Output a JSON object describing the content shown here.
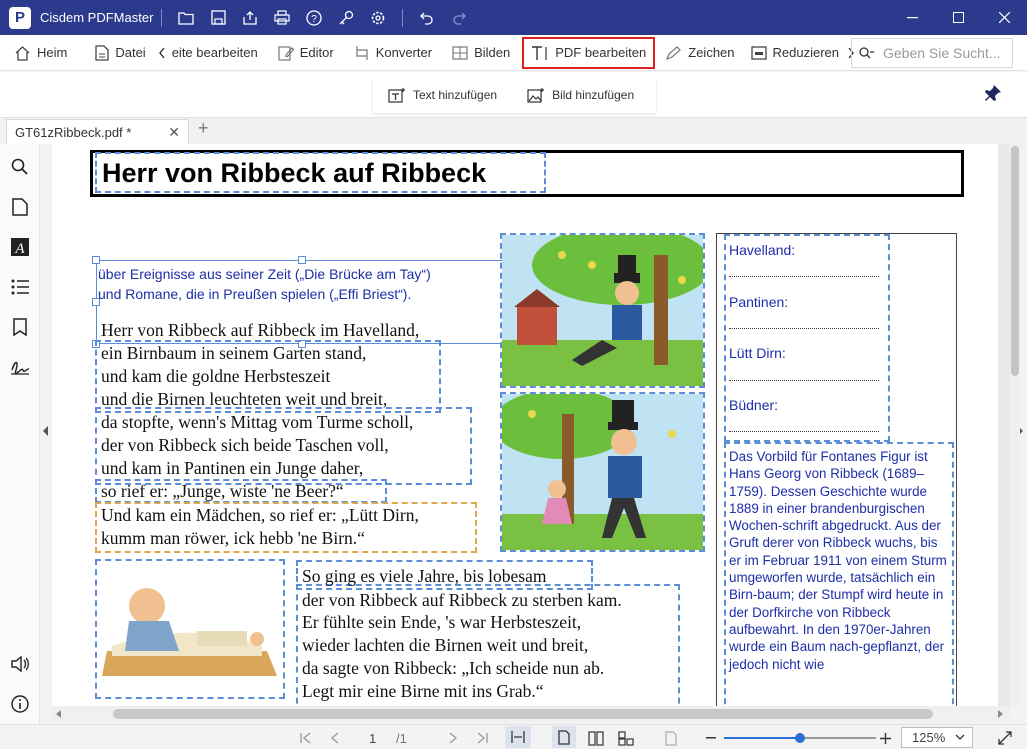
{
  "app": {
    "title": "Cisdem PDFMaster",
    "logo_letter": "P"
  },
  "menu": {
    "home": "Heim",
    "file": "Datei",
    "edit_pages": "eite bearbeiten",
    "editor": "Editor",
    "converter": "Konverter",
    "images": "Bilden",
    "edit_pdf": "PDF bearbeiten",
    "draw": "Zeichen",
    "reduce": "Reduzieren",
    "search_placeholder": "Geben Sie Sucht..."
  },
  "subtoolbar": {
    "add_text": "Text hinzufügen",
    "add_image": "Bild hinzufügen"
  },
  "tabs": [
    {
      "label": "GT61zRibbeck.pdf *"
    }
  ],
  "document": {
    "title": "Herr von Ribbeck auf Ribbeck",
    "blue_para": [
      "über Ereignisse aus seiner Zeit („Die Brücke am Tay“)",
      "und Romane, die in Preußen spielen („Effi Briest“)."
    ],
    "poem": [
      "Herr von Ribbeck auf Ribbeck im Havelland,",
      "ein Birnbaum in seinem Garten stand,",
      "und kam die goldne Herbsteszeit",
      "und die Birnen leuchteten weit und breit,",
      "da stopfte, wenn's Mittag vom Turme scholl,",
      "der von Ribbeck sich beide Taschen voll,",
      "und kam in Pantinen ein Junge daher,",
      "so rief er: „Junge, wiste 'ne Beer?“",
      "Und kam ein Mädchen, so rief er: „Lütt Dirn,",
      "kumm man röwer, ick hebb 'ne Birn.“",
      "So ging es viele Jahre, bis lobesam",
      "der von Ribbeck auf Ribbeck zu sterben kam.",
      "Er fühlte sein Ende, 's war Herbsteszeit,",
      "wieder lachten die Birnen weit und breit,",
      "da sagte von Ribbeck: „Ich scheide nun ab.",
      "Legt mir eine Birne mit ins Grab.“"
    ],
    "fields": [
      "Havelland:",
      "Pantinen:",
      "Lütt Dirn:",
      "Büdner:"
    ],
    "info": "Das Vorbild für Fontanes Figur ist Hans Georg von Ribbeck (1689–1759). Dessen Geschichte wurde 1889 in einer brandenburgischen Wochen-schrift abgedruckt. Aus der Gruft derer von Ribbeck wuchs, bis er im Februar 1911 von einem Sturm umgeworfen wurde, tatsächlich ein Birn-baum; der Stumpf wird heute in der Dorfkirche von Ribbeck aufbewahrt. In den 1970er-Jahren wurde ein Baum nach-gepflanzt, der jedoch nicht wie"
  },
  "status": {
    "page_current": "1",
    "page_total": "/1",
    "zoom": "125%",
    "zoom_fraction": 0.5
  },
  "colors": {
    "titlebar": "#2b3a8c",
    "accent_red": "#e02020",
    "text_blue": "#1e2ea8",
    "selection": "#5b8ed6"
  }
}
